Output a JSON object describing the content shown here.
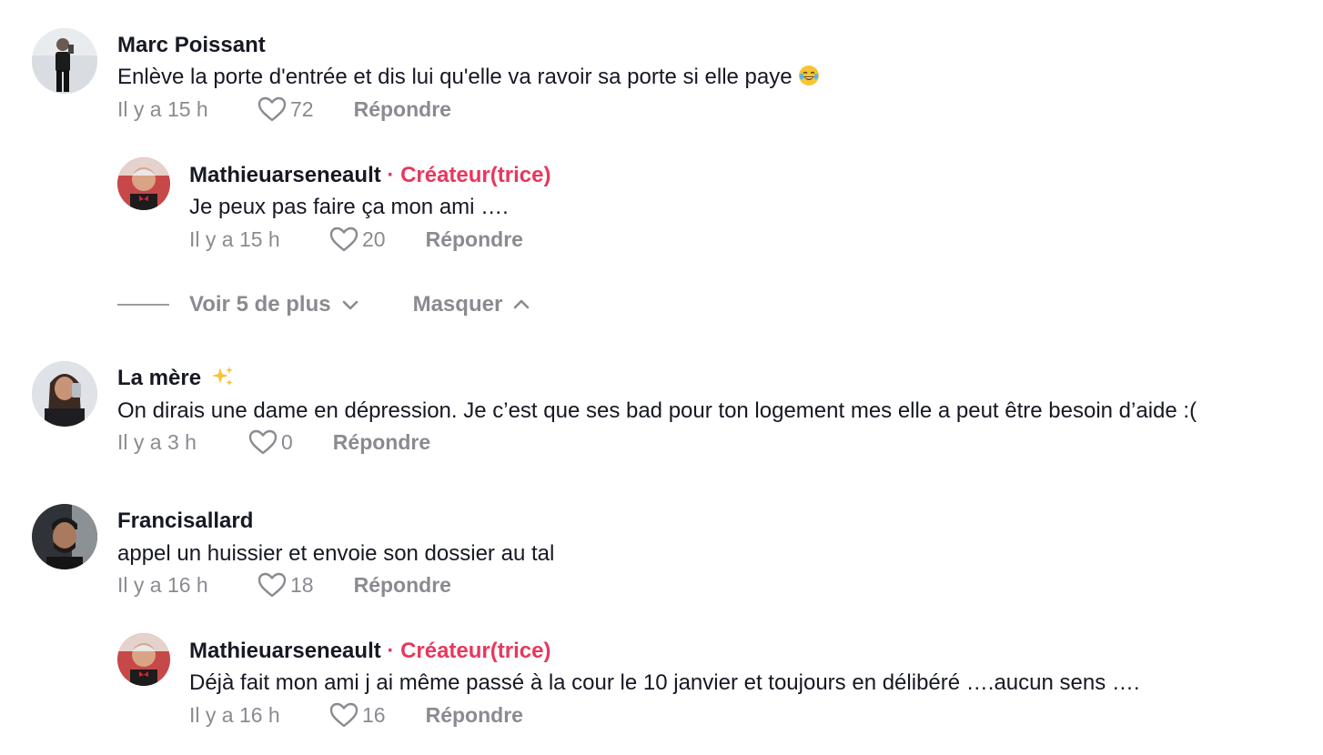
{
  "comments": [
    {
      "author": "Marc Poissant",
      "text": "Enlève la porte d'entrée et dis lui qu'elle va ravoir sa porte si elle paye",
      "emoji": "tears-of-joy",
      "time": "Il y a 15 h",
      "likes": "72",
      "reply_label": "Répondre",
      "replies": [
        {
          "author": "Mathieuarseneault",
          "badge": "· Créateur(trice)",
          "text": "Je peux pas faire ça mon ami ….",
          "time": "Il y a 15 h",
          "likes": "20",
          "reply_label": "Répondre"
        }
      ],
      "thread_controls": {
        "more_label": "Voir 5 de plus",
        "hide_label": "Masquer"
      }
    },
    {
      "author": "La mère",
      "author_emoji": "sparkles",
      "text": "On dirais une dame en dépression. Je c’est que ses bad pour ton logement mes elle a peut être besoin d’aide :(",
      "time": "Il y a 3 h",
      "likes": "0",
      "reply_label": "Répondre"
    },
    {
      "author": "Francisallard",
      "text": "appel un huissier et envoie son dossier au tal",
      "time": "Il y a 16 h",
      "likes": "18",
      "reply_label": "Répondre",
      "replies": [
        {
          "author": "Mathieuarseneault",
          "badge": "· Créateur(trice)",
          "text": "Déjà fait mon ami j ai même passé à la cour le 10 janvier et toujours en délibéré ….aucun sens ….",
          "time": "Il y a 16 h",
          "likes": "16",
          "reply_label": "Répondre"
        }
      ]
    }
  ],
  "colors": {
    "creator_badge": "#e8375d",
    "muted": "#8a8b91",
    "text": "#161823"
  }
}
